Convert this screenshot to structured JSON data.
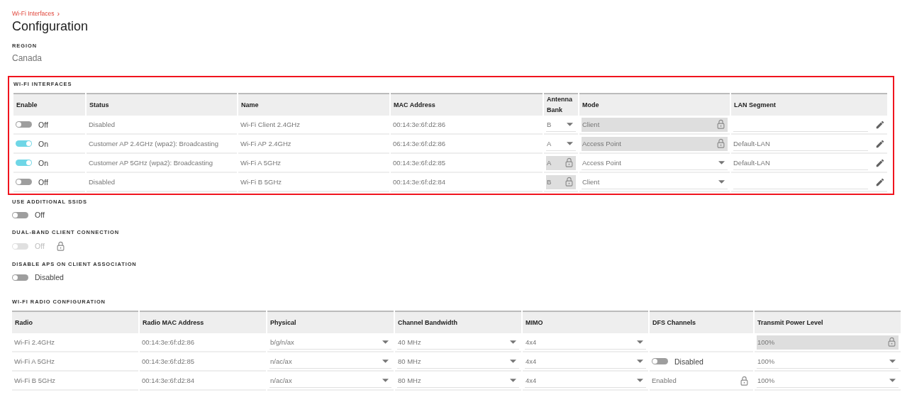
{
  "breadcrumb": {
    "label": "Wi-Fi Interfaces",
    "separator": "›"
  },
  "title": "Configuration",
  "region": {
    "label": "REGION",
    "value": "Canada"
  },
  "interfaces": {
    "title": "WI-FI INTERFACES",
    "highlighted": true,
    "columns": [
      "Enable",
      "Status",
      "Name",
      "MAC Address",
      "Antenna Bank",
      "Mode",
      "LAN Segment"
    ],
    "rows": [
      {
        "enable": {
          "on": false,
          "label": "Off"
        },
        "status": "Disabled",
        "name": "Wi-Fi Client 2.4GHz",
        "mac": "00:14:3e:6f:d2:86",
        "antenna": {
          "value": "B",
          "locked": false
        },
        "mode": {
          "value": "Client",
          "locked": true
        }
      },
      {
        "enable": {
          "on": true,
          "label": "On"
        },
        "status": "Customer AP 2.4GHz (wpa2): Broadcasting",
        "name": "Wi-Fi AP 2.4GHz",
        "mac": "06:14:3e:6f:d2:86",
        "antenna": {
          "value": "A",
          "locked": false
        },
        "mode": {
          "value": "Access Point",
          "locked": true
        },
        "lan": "Default-LAN"
      },
      {
        "enable": {
          "on": true,
          "label": "On"
        },
        "status": "Customer AP 5GHz (wpa2): Broadcasting",
        "name": "Wi-Fi A 5GHz",
        "mac": "00:14:3e:6f:d2:85",
        "antenna": {
          "value": "A",
          "locked": true
        },
        "mode": {
          "value": "Access Point",
          "locked": false
        },
        "lan": "Default-LAN"
      },
      {
        "enable": {
          "on": false,
          "label": "Off"
        },
        "status": "Disabled",
        "name": "Wi-Fi B 5GHz",
        "mac": "00:14:3e:6f:d2:84",
        "antenna": {
          "value": "B",
          "locked": true
        },
        "mode": {
          "value": "Client",
          "locked": false
        }
      }
    ]
  },
  "settings": [
    {
      "label": "USE ADDITIONAL SSIDS",
      "on": false,
      "state_label": "Off",
      "disabled": false
    },
    {
      "label": "DUAL-BAND CLIENT CONNECTION",
      "on": false,
      "state_label": "Off",
      "disabled": true
    },
    {
      "label": "DISABLE APS ON CLIENT ASSOCIATION",
      "on": false,
      "state_label": "Disabled",
      "disabled": false
    }
  ],
  "radio": {
    "title": "WI-FI RADIO CONFIGURATION",
    "columns": [
      "Radio",
      "Radio MAC Address",
      "Physical",
      "Channel Bandwidth",
      "MIMO",
      "DFS Channels",
      "Transmit Power Level"
    ],
    "rows": [
      {
        "radio": "Wi-Fi 2.4GHz",
        "mac": "00:14:3e:6f:d2:86",
        "physical": "b/g/n/ax",
        "bandwidth": "40 MHz",
        "mimo": "4x4",
        "power": {
          "value": "100%",
          "locked": true
        }
      },
      {
        "radio": "Wi-Fi A 5GHz",
        "mac": "00:14:3e:6f:d2:85",
        "physical": "n/ac/ax",
        "bandwidth": "80 MHz",
        "mimo": "4x4",
        "dfs": {
          "kind": "toggle",
          "on": false,
          "label": "Disabled"
        },
        "power": {
          "value": "100%",
          "locked": false
        }
      },
      {
        "radio": "Wi-Fi B 5GHz",
        "mac": "00:14:3e:6f:d2:84",
        "physical": "n/ac/ax",
        "bandwidth": "80 MHz",
        "mimo": "4x4",
        "dfs": {
          "kind": "text",
          "value": "Enabled",
          "locked": true
        },
        "power": {
          "value": "100%",
          "locked": false
        }
      }
    ]
  }
}
